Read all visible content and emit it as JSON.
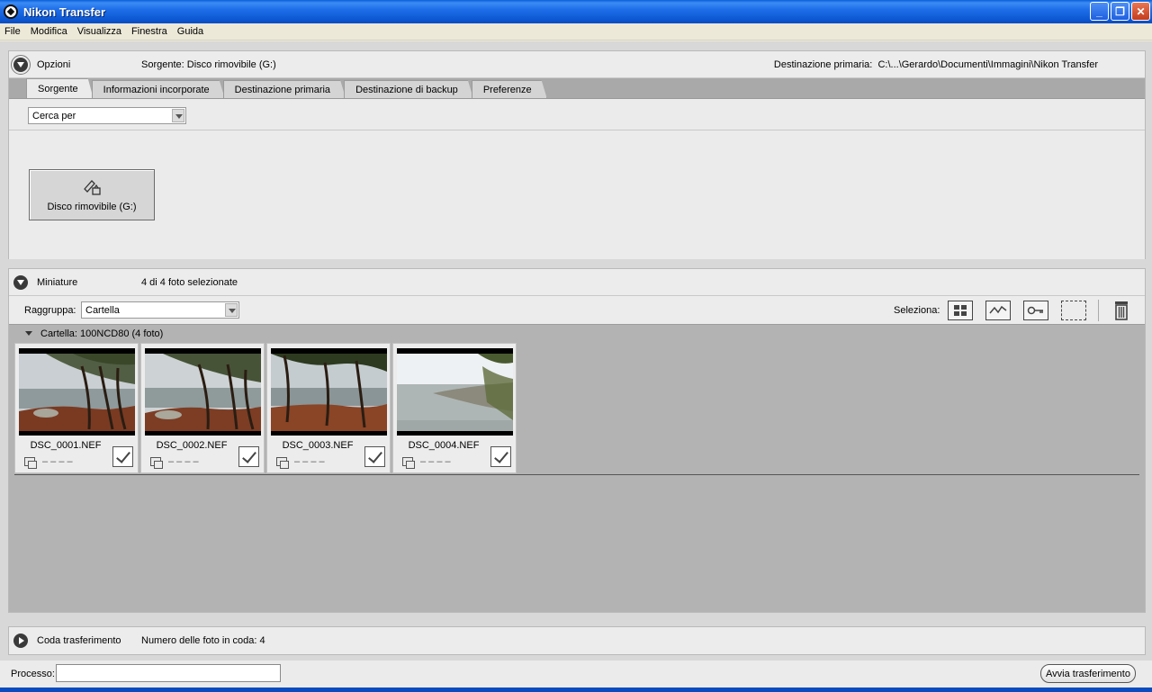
{
  "window": {
    "title": "Nikon Transfer",
    "controls": [
      "_",
      "❐",
      "✕"
    ]
  },
  "menu": [
    "File",
    "Modifica",
    "Visualizza",
    "Finestra",
    "Guida"
  ],
  "options": {
    "label": "Opzioni",
    "source": "Sorgente: Disco rimovibile (G:)",
    "primary_dest_label": "Destinazione primaria:",
    "primary_dest_path": "C:\\...\\Gerardo\\Documenti\\Immagini\\Nikon Transfer",
    "tabs": [
      "Sorgente",
      "Informazioni incorporate",
      "Destinazione primaria",
      "Destinazione di backup",
      "Preferenze"
    ],
    "active_tab": "Sorgente",
    "search_dropdown": "Cerca per",
    "device": {
      "label": "Disco rimovibile (G:)",
      "icon": "usb-drive-icon"
    }
  },
  "thumbnails": {
    "label": "Miniature",
    "count": "4 di 4 foto selezionate",
    "group_label": "Raggruppa:",
    "group_value": "Cartella",
    "select_label": "Seleziona:",
    "select_icons": [
      "select-all-icon",
      "select-new-icon",
      "select-protected-icon",
      "deselect-icon",
      "delete-icon"
    ],
    "folder": "Cartella: 100NCD80 (4 foto)",
    "items": [
      {
        "name": "DSC_0001.NEF",
        "meta": "– – – –",
        "checked": true
      },
      {
        "name": "DSC_0002.NEF",
        "meta": "– – – –",
        "checked": true
      },
      {
        "name": "DSC_0003.NEF",
        "meta": "– – – –",
        "checked": true
      },
      {
        "name": "DSC_0004.NEF",
        "meta": "– – – –",
        "checked": true
      }
    ]
  },
  "queue": {
    "label": "Coda trasferimento",
    "count": "Numero delle foto in coda: 4"
  },
  "status": {
    "label": "Processo:",
    "value": "",
    "start_button": "Avvia trasferimento"
  },
  "colors": {
    "titlebar": "#0b56d1",
    "panel": "#ebebeb",
    "thumb_area": "#b3b3b3"
  }
}
